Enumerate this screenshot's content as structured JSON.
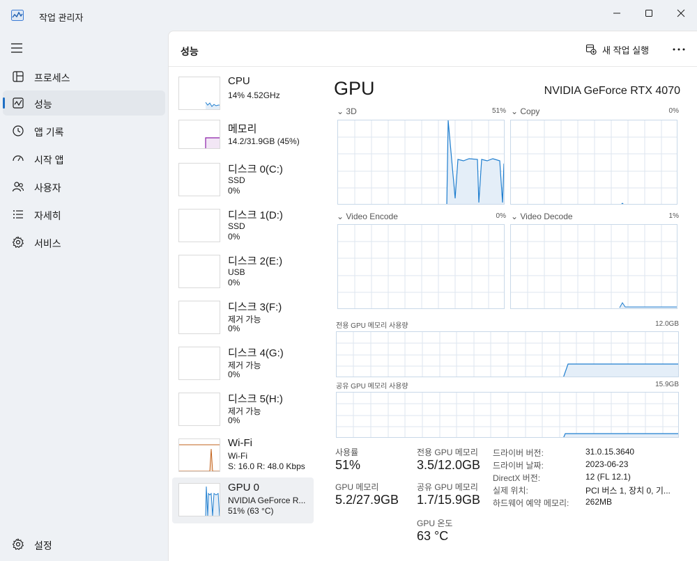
{
  "window": {
    "title": "작업 관리자",
    "icon": "task-manager-chart-icon"
  },
  "sidebar": {
    "items": [
      {
        "label": "프로세스",
        "icon": "processes-grid-icon"
      },
      {
        "label": "성능",
        "icon": "performance-chart-icon",
        "active": true
      },
      {
        "label": "앱 기록",
        "icon": "history-clock-icon"
      },
      {
        "label": "시작 앱",
        "icon": "startup-speedometer-icon"
      },
      {
        "label": "사용자",
        "icon": "users-icon"
      },
      {
        "label": "자세히",
        "icon": "details-list-icon"
      },
      {
        "label": "서비스",
        "icon": "services-gear-icon"
      }
    ],
    "settings_label": "설정"
  },
  "header": {
    "title": "성능",
    "run_task_label": "새 작업 실행",
    "more_label": "..."
  },
  "perf_list": [
    {
      "name": "CPU",
      "lines": [
        "14% 4.52GHz"
      ],
      "color": "#1f7ecf"
    },
    {
      "name": "메모리",
      "lines": [
        "14.2/31.9GB (45%)"
      ],
      "color": "#8b1fa8"
    },
    {
      "name": "디스크 0(C:)",
      "lines": [
        "SSD",
        "0%"
      ],
      "color": "#4e9a06"
    },
    {
      "name": "디스크 1(D:)",
      "lines": [
        "SSD",
        "0%"
      ],
      "color": "#4e9a06"
    },
    {
      "name": "디스크 2(E:)",
      "lines": [
        "USB",
        "0%"
      ],
      "color": "#4e9a06"
    },
    {
      "name": "디스크 3(F:)",
      "lines": [
        "제거 가능",
        "0%"
      ],
      "color": "#4e9a06"
    },
    {
      "name": "디스크 4(G:)",
      "lines": [
        "제거 가능",
        "0%"
      ],
      "color": "#4e9a06"
    },
    {
      "name": "디스크 5(H:)",
      "lines": [
        "제거 가능",
        "0%"
      ],
      "color": "#4e9a06"
    },
    {
      "name": "Wi-Fi",
      "lines": [
        "Wi-Fi",
        "S: 16.0  R: 48.0 Kbps"
      ],
      "color": "#c2621b"
    },
    {
      "name": "GPU 0",
      "lines": [
        "NVIDIA GeForce R...",
        "51% (63 °C)"
      ],
      "color": "#1f7ecf",
      "selected": true
    }
  ],
  "gpu": {
    "title": "GPU",
    "model": "NVIDIA GeForce RTX 4070",
    "accent": "#1f7ecf",
    "engines": [
      {
        "name": "3D",
        "value": "51%"
      },
      {
        "name": "Copy",
        "value": "0%"
      },
      {
        "name": "Video Encode",
        "value": "0%"
      },
      {
        "name": "Video Decode",
        "value": "1%"
      }
    ],
    "dedicated_label": "전용 GPU 메모리 사용량",
    "dedicated_max": "12.0GB",
    "shared_label": "공유 GPU 메모리 사용량",
    "shared_max": "15.9GB"
  },
  "stats": {
    "utilization": {
      "label": "사용률",
      "value": "51%"
    },
    "dedicated": {
      "label": "전용 GPU 메모리",
      "value": "3.5/12.0GB"
    },
    "gpu_memory": {
      "label": "GPU 메모리",
      "value": "5.2/27.9GB"
    },
    "shared": {
      "label": "공유 GPU 메모리",
      "value": "1.7/15.9GB"
    },
    "temperature": {
      "label": "GPU 온도",
      "value": "63 °C"
    }
  },
  "info": [
    {
      "key": "드라이버 버전:",
      "value": "31.0.15.3640"
    },
    {
      "key": "드라이버 날짜:",
      "value": "2023-06-23"
    },
    {
      "key": "DirectX 버전:",
      "value": "12 (FL 12.1)"
    },
    {
      "key": "실제 위치:",
      "value": "PCI 버스 1, 장치 0, 기..."
    },
    {
      "key": "하드웨어 예약 메모리:",
      "value": "262MB"
    }
  ]
}
